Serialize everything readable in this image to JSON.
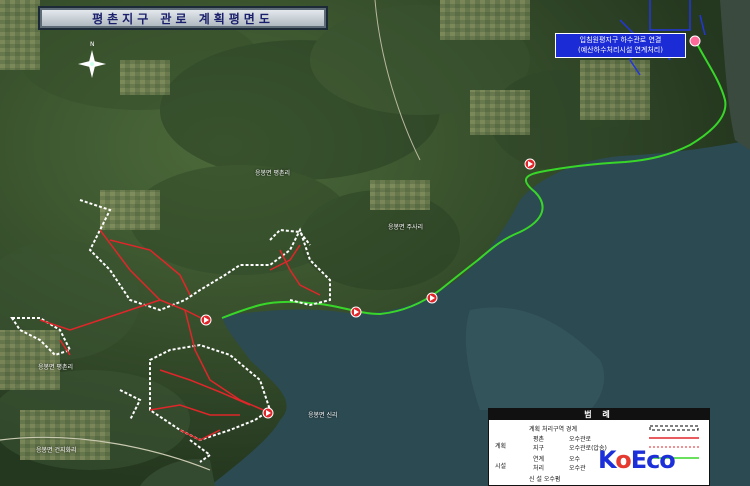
{
  "title": "평촌지구 관로 계획평면도",
  "callout": {
    "line1": "입침원평지구 하수관로 연결",
    "line2": "(예산하수처리시설 연계처리)"
  },
  "compass": {
    "north": "N"
  },
  "villages": [
    {
      "label": "응봉면 평촌리"
    },
    {
      "label": "응봉면 주사리"
    },
    {
      "label": "응봉면 평촌리"
    },
    {
      "label": "응봉면 신리"
    },
    {
      "label": "응봉면 건지화리"
    }
  ],
  "legend": {
    "title": "범 례",
    "boundary_label": "계획 처리구역 경계",
    "group_plan": "계획",
    "group_facility": "시설",
    "rows": [
      {
        "sub": "평촌",
        "item": "오수관로"
      },
      {
        "sub": "지구",
        "item": "오수관로(압송)"
      },
      {
        "sub": "연계",
        "item": "오수"
      },
      {
        "sub": "처리",
        "item": "오수관"
      }
    ],
    "bottom": "신 설 오수펌"
  },
  "logo": {
    "k": "K",
    "o": "o",
    "eco": "Eco"
  },
  "colors": {
    "water": "#2c4a52",
    "gravity_pipe": "#e0262a",
    "link_pipe": "#39d62a",
    "boundary": "#ffffff",
    "callout_bg": "#1b2bd6"
  },
  "pumps": 5
}
